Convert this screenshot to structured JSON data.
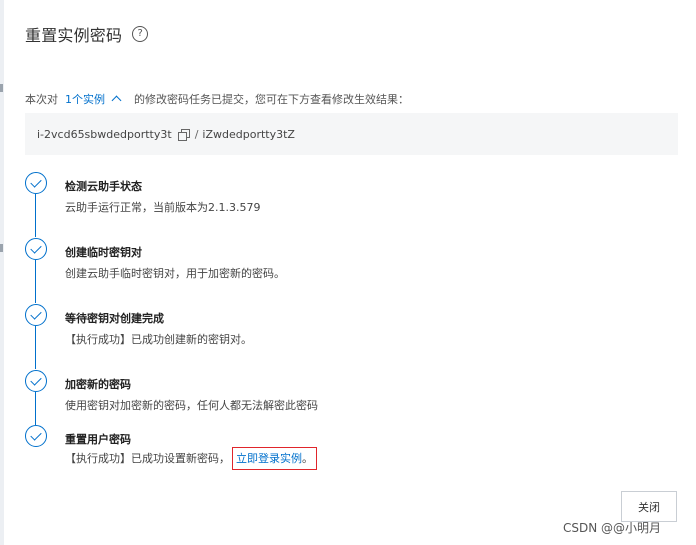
{
  "dialog": {
    "title": "重置实例密码",
    "help_icon": "question-circle-icon",
    "summary": {
      "prefix": "本次对",
      "instance_link": "1个实例",
      "suffix": "的修改密码任务已提交，您可在下方查看修改生效结果："
    },
    "instance": {
      "id": "i-2vcd65sbwdedportty3t",
      "separator": "/",
      "name": "iZwdedportty3tZ"
    },
    "steps": [
      {
        "title": "检测云助手状态",
        "desc": "云助手运行正常，当前版本为2.1.3.579"
      },
      {
        "title": "创建临时密钥对",
        "desc": "创建云助手临时密钥对，用于加密新的密码。"
      },
      {
        "title": "等待密钥对创建完成",
        "desc": "【执行成功】已成功创建新的密钥对。"
      },
      {
        "title": "加密新的密码",
        "desc": "使用密钥对加密新的密码，任何人都无法解密此密码"
      },
      {
        "title": "重置用户密码",
        "desc": "【执行成功】已成功设置新密码，",
        "link": "立即登录实例",
        "link_suffix": "。"
      }
    ],
    "close_label": "关闭"
  },
  "watermark": "CSDN @@小明月",
  "colors": {
    "accent": "#0070cc",
    "highlight_border": "#e0252b",
    "panel_bg": "#f5f6f7"
  }
}
